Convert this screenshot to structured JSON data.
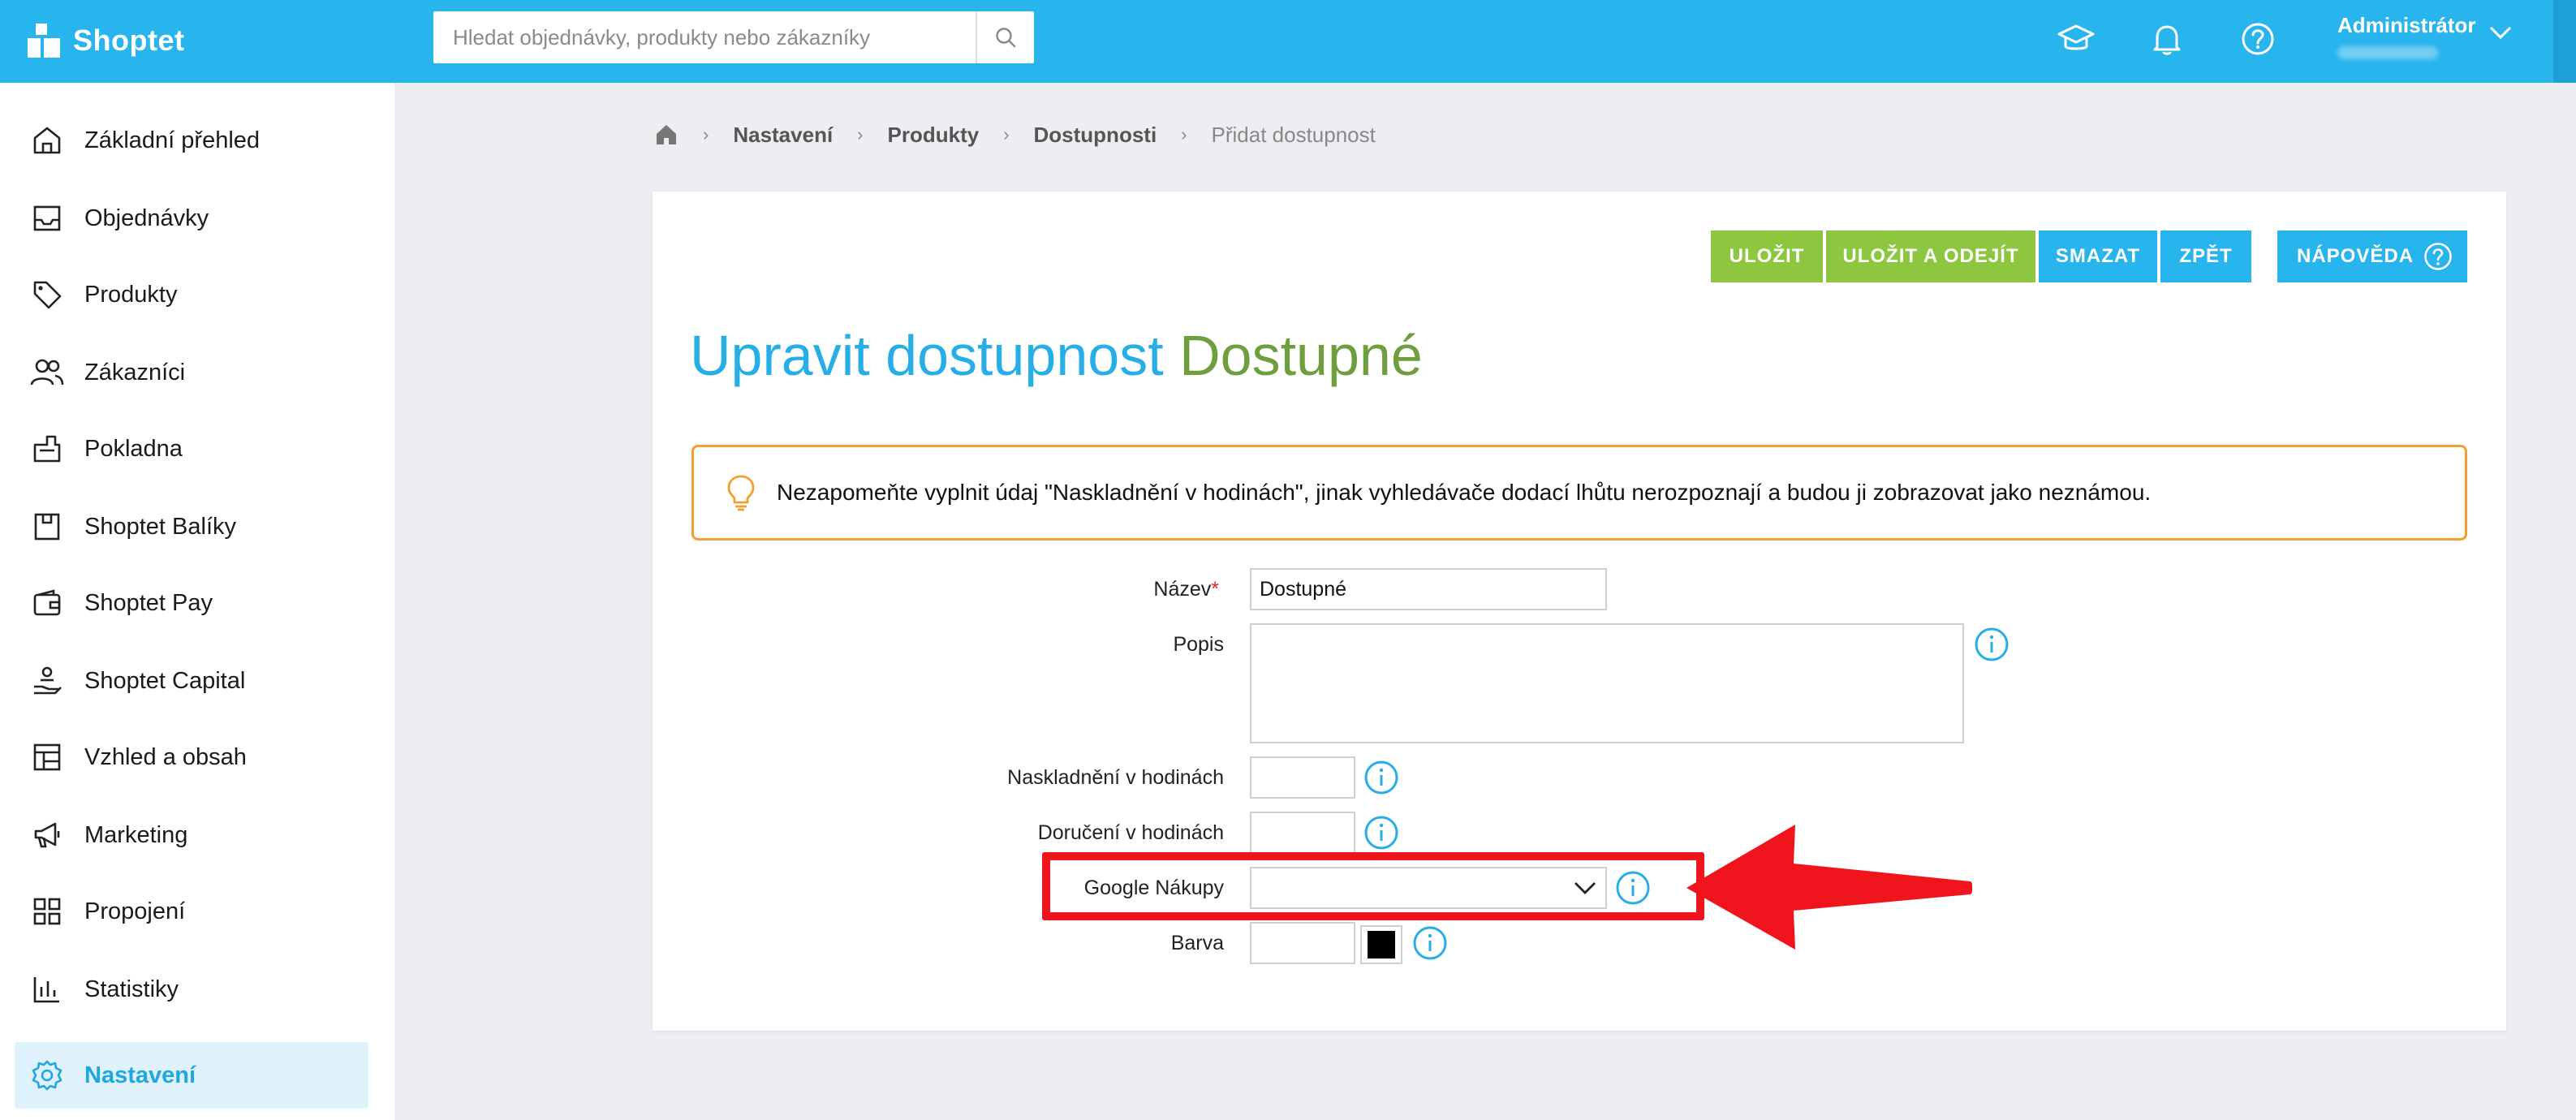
{
  "app": {
    "brand": "Shoptet"
  },
  "search": {
    "placeholder": "Hledat objednávky, produkty nebo zákazníky"
  },
  "topbar": {
    "icons": [
      "graduation-cap-icon",
      "bell-icon",
      "help-icon"
    ],
    "user_name": "Administrátor"
  },
  "sidebar": {
    "items": [
      {
        "label": "Základní přehled",
        "icon": "home-icon"
      },
      {
        "label": "Objednávky",
        "icon": "inbox-icon"
      },
      {
        "label": "Produkty",
        "icon": "tag-icon"
      },
      {
        "label": "Zákazníci",
        "icon": "users-icon"
      },
      {
        "label": "Pokladna",
        "icon": "cash-register-icon"
      },
      {
        "label": "Shoptet Balíky",
        "icon": "package-icon"
      },
      {
        "label": "Shoptet Pay",
        "icon": "wallet-icon"
      },
      {
        "label": "Shoptet Capital",
        "icon": "hand-coins-icon"
      },
      {
        "label": "Vzhled a obsah",
        "icon": "layout-icon"
      },
      {
        "label": "Marketing",
        "icon": "megaphone-icon"
      },
      {
        "label": "Propojení",
        "icon": "grid-icon"
      },
      {
        "label": "Statistiky",
        "icon": "bar-chart-icon"
      },
      {
        "label": "Nastavení",
        "icon": "gear-icon",
        "active": true
      }
    ]
  },
  "breadcrumb": {
    "items": [
      "Nastavení",
      "Produkty",
      "Dostupnosti"
    ],
    "current": "Přidat dostupnost"
  },
  "toolbar": {
    "save": "ULOŽIT",
    "save_exit": "ULOŽIT A ODEJÍT",
    "delete": "SMAZAT",
    "back": "ZPĚT",
    "help": "NÁPOVĚDA"
  },
  "page": {
    "title_prefix": "Upravit dostupnost",
    "title_name": "Dostupné"
  },
  "notice": {
    "text": "Nezapomeňte vyplnit údaj \"Naskladnění v hodinách\", jinak vyhledávače dodací lhůtu nerozpoznají a budou ji zobrazovat jako neznámou."
  },
  "form": {
    "name_label": "Název",
    "name_value": "Dostupné",
    "description_label": "Popis",
    "description_value": "",
    "stock_hours_label": "Naskladnění v hodinách",
    "stock_hours_value": "",
    "delivery_hours_label": "Doručení v hodinách",
    "delivery_hours_value": "",
    "google_label": "Google Nákupy",
    "google_value": "",
    "color_label": "Barva",
    "color_value": "",
    "color_swatch": "#000000"
  },
  "colors": {
    "topbar": "#28b4ec",
    "accent_blue": "#28aee6",
    "accent_green": "#8dc63f",
    "title_green": "#6f9e3e",
    "notice_border": "#f0a032",
    "highlight": "#f0141c"
  }
}
